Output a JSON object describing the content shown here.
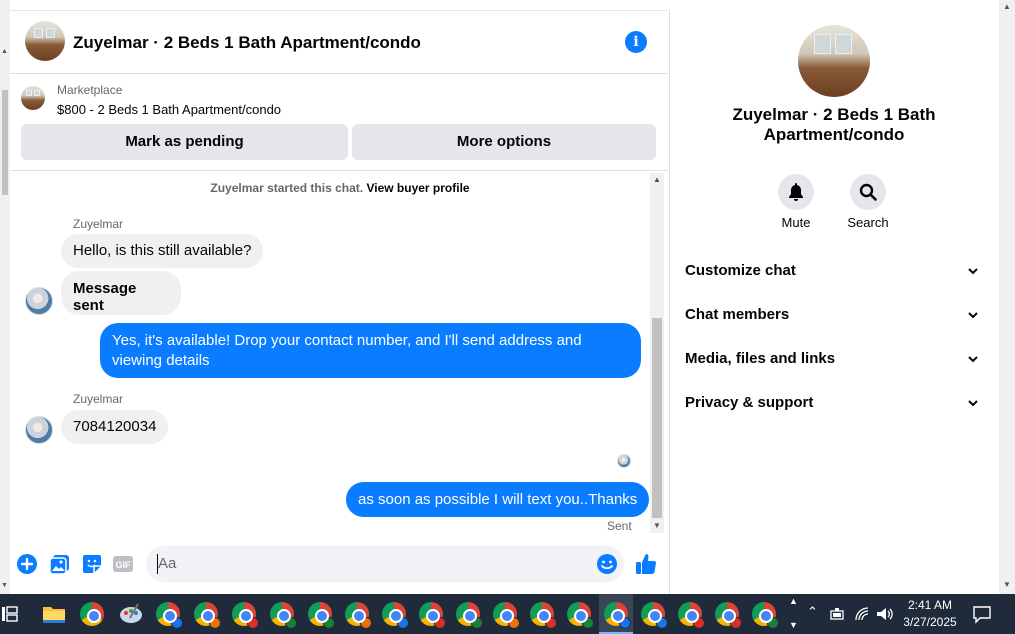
{
  "chat_header": {
    "title": "Zuyelmar · 2 Beds 1 Bath Apartment/condo"
  },
  "marketplace": {
    "label": "Marketplace",
    "listing": "$800 - 2 Beds 1 Bath Apartment/condo",
    "pending_button": "Mark as pending",
    "more_button": "More options"
  },
  "thread": {
    "started_text": "Zuyelmar started this chat.",
    "buyer_profile_link": "View buyer profile",
    "messages": [
      {
        "sender": "Zuyelmar",
        "text": "Hello, is this still available?"
      },
      {
        "text": "Message sent"
      },
      {
        "text": "Yes, it's available! Drop your contact number, and I'll send address and viewing details"
      },
      {
        "sender": "Zuyelmar",
        "text": "7084120034"
      },
      {
        "text": "as soon as possible I will text you..Thanks"
      }
    ],
    "status": "Sent"
  },
  "composer": {
    "placeholder": "Aa"
  },
  "right_panel": {
    "title_line1": "Zuyelmar · 2 Beds 1 Bath",
    "title_line2": "Apartment/condo",
    "mute_label": "Mute",
    "search_label": "Search",
    "sections": [
      "Customize chat",
      "Chat members",
      "Media, files and links",
      "Privacy & support"
    ]
  },
  "taskbar": {
    "time": "2:41 AM",
    "date": "3/27/2025"
  },
  "colors": {
    "accent": "#0a7cff",
    "bubble_in": "#f0f0f0",
    "button_grey": "#e4e6eb",
    "taskbar": "#1f2b3a"
  }
}
